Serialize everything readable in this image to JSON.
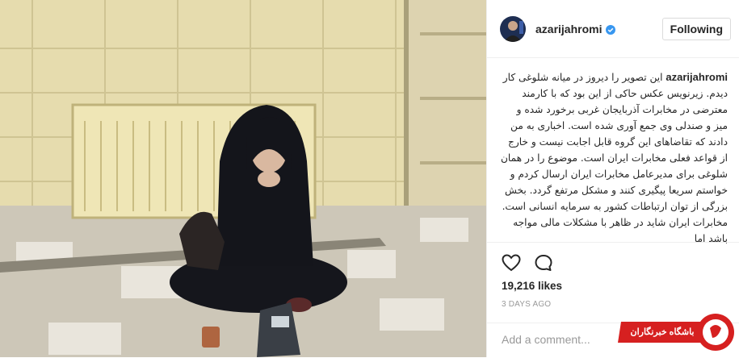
{
  "post": {
    "image_alt": "woman sitting on office floor",
    "username": "azarijahromi",
    "follow_label": "Following",
    "caption": "این تصویر را دیروز در میانه شلوغی کار دیدم. زیرنویس عکس حاکی از این بود که با کارمند معترضی در مخابرات آذربایجان غربی برخورد شده و میز و صندلی وی جمع آوری شده است. اخباری به من دادند که تقاضاهای این گروه قابل اجابت نیست و خارج از قواعد فعلی مخابرات ایران است. موضوع را در همان شلوغی برای مدیرعامل مخابرات ایران ارسال کردم و خواستم سریعا پیگیری کنند و مشکل مرتفع گردد. بخش بزرگی از توان ارتباطات کشور به سرمایه انسانی است. مخابرات ایران شاید در ظاهر با مشکلات مالی مواجه باشد اما",
    "likes": "19,216 likes",
    "date": "3 DAYS AGO",
    "comment_placeholder": "Add a comment..."
  },
  "icons": {
    "like": "heart-icon",
    "comment": "speech-bubble-icon",
    "verified": "verified-badge-icon"
  },
  "watermark": {
    "text": "باشگاه خبرنگاران"
  },
  "colors": {
    "verified": "#3897f0",
    "watermark": "#d62020"
  }
}
